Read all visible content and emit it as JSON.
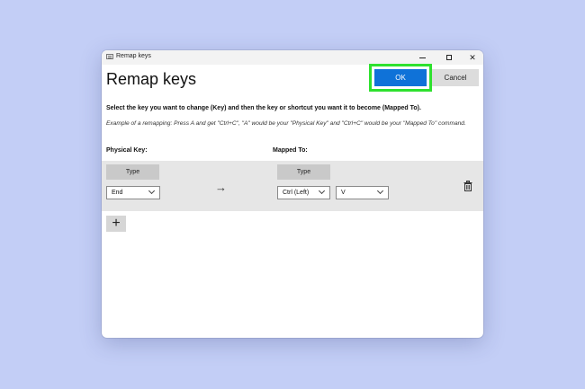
{
  "window": {
    "title": "Remap keys"
  },
  "header": {
    "title": "Remap keys",
    "ok_label": "OK",
    "cancel_label": "Cancel"
  },
  "instruction": "Select the key you want to change (Key) and then the key or shortcut you want it to become (Mapped To).",
  "example": "Example of a remapping: Press A and get \"Ctrl+C\", \"A\" would be your \"Physical Key\" and \"Ctrl+C\" would be your \"Mapped To\" command.",
  "columns": {
    "physical": "Physical Key:",
    "mapped": "Mapped To:"
  },
  "mapping_row": {
    "type_label": "Type",
    "physical_key": "End",
    "mapped_modifier": "Ctrl (Left)",
    "mapped_key": "V",
    "arrow": "→"
  },
  "add_label": "+",
  "colors": {
    "accent": "#0f72d8",
    "highlight": "#2ee12e",
    "background": "#c3cef6"
  },
  "icons": [
    "app-icon",
    "minimize-icon",
    "maximize-icon",
    "close-icon",
    "arrow-right-icon",
    "trash-icon",
    "plus-icon",
    "chevron-down-icon"
  ]
}
